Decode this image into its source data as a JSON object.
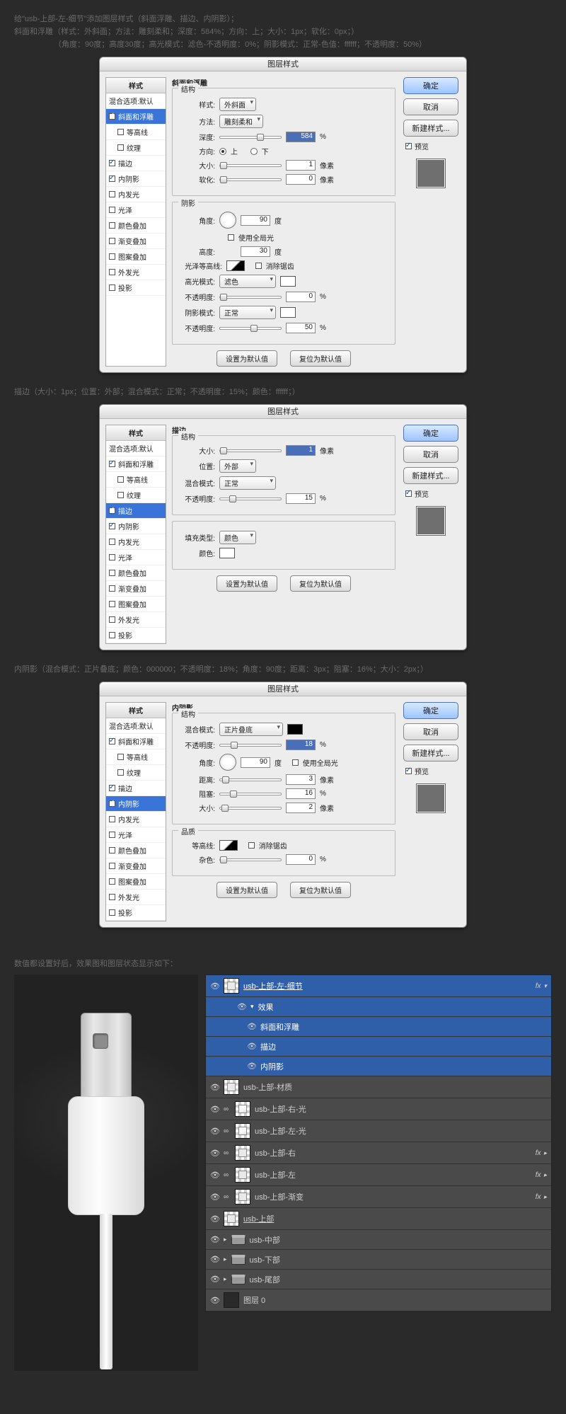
{
  "intro": {
    "line1": "给\"usb-上部-左-细节\"添加图层样式（斜面浮雕、描边、内阴影）；",
    "line2": "斜面和浮雕（样式：外斜面；方法：雕刻柔和；深度：584%；方向：上；大小：1px；软化：0px；）",
    "line3": "（角度：90度；高度30度；高光模式：滤色-不透明度：0%；阴影模式：正常-色值：ffffff；不透明度：50%）"
  },
  "strokeIntro": "描边（大小：1px；位置：外部；混合模式：正常；不透明度：15%；颜色：ffffff；）",
  "innerIntro": "内阴影（混合模式：正片叠底；颜色：000000；不透明度：18%；角度：90度；距离：3px；阻塞：16%；大小：2px；）",
  "resultIntro": "数值都设置好后，效果图和图层状态显示如下：",
  "dlg": {
    "title": "图层样式",
    "ok": "确定",
    "cancel": "取消",
    "new": "新建样式...",
    "preview": "预览",
    "defaultBtn": "设置为默认值",
    "resetBtn": "复位为默认值"
  },
  "styles": {
    "head": "样式",
    "default": "混合选项:默认",
    "items": [
      "斜面和浮雕",
      "等高线",
      "纹理",
      "描边",
      "内阴影",
      "内发光",
      "光泽",
      "颜色叠加",
      "渐变叠加",
      "图案叠加",
      "外发光",
      "投影"
    ]
  },
  "bevel": {
    "title": "斜面和浮雕",
    "structure": "结构",
    "styleLbl": "样式:",
    "styleVal": "外斜面",
    "methodLbl": "方法:",
    "methodVal": "雕刻柔和",
    "depthLbl": "深度:",
    "depthVal": "584",
    "pct": "%",
    "dirLbl": "方向:",
    "up": "上",
    "down": "下",
    "sizeLbl": "大小:",
    "sizeVal": "1",
    "px": "像素",
    "softLbl": "软化:",
    "softVal": "0",
    "shade": "阴影",
    "angleLbl": "角度:",
    "angleVal": "90",
    "deg": "度",
    "globalLight": "使用全局光",
    "altLbl": "高度:",
    "altVal": "30",
    "glossLbl": "光泽等高线:",
    "anti": "消除锯齿",
    "hlModeLbl": "高光模式:",
    "hlModeVal": "滤色",
    "opLbl": "不透明度:",
    "hlOp": "0",
    "shModeLbl": "阴影模式:",
    "shModeVal": "正常",
    "shOp": "50"
  },
  "stroke": {
    "title": "描边",
    "structure": "结构",
    "sizeLbl": "大小:",
    "sizeVal": "1",
    "px": "像素",
    "posLbl": "位置:",
    "posVal": "外部",
    "blendLbl": "混合模式:",
    "blendVal": "正常",
    "opLbl": "不透明度:",
    "opVal": "15",
    "pct": "%",
    "fillType": "填充类型:",
    "fillVal": "颜色",
    "colorLbl": "颜色:"
  },
  "inner": {
    "title": "内阴影",
    "structure": "结构",
    "blendLbl": "混合模式:",
    "blendVal": "正片叠底",
    "opLbl": "不透明度:",
    "opVal": "18",
    "pct": "%",
    "angleLbl": "角度:",
    "angleVal": "90",
    "deg": "度",
    "global": "使用全局光",
    "distLbl": "距离:",
    "distVal": "3",
    "px": "像素",
    "chokeLbl": "阻塞:",
    "chokeVal": "16",
    "sizeLbl": "大小:",
    "sizeVal": "2",
    "quality": "品质",
    "contourLbl": "等高线:",
    "anti": "消除锯齿",
    "noiseLbl": "杂色:",
    "noiseVal": "0"
  },
  "layers": {
    "fx": "fx",
    "effects": "效果",
    "eff_bevel": "斜面和浮雕",
    "eff_stroke": "描边",
    "eff_inner": "内阴影",
    "rows": [
      {
        "name": "usb-上部-左-细节",
        "fx": true,
        "sel": true
      },
      {
        "name": "usb-上部-材质"
      },
      {
        "name": "usb-上部-右-光"
      },
      {
        "name": "usb-上部-左-光"
      },
      {
        "name": "usb-上部-右",
        "fx": true
      },
      {
        "name": "usb-上部-左",
        "fx": true
      },
      {
        "name": "usb-上部-渐变",
        "fx": true
      },
      {
        "name": "usb-上部",
        "underline": true
      }
    ],
    "folders": [
      "usb-中部",
      "usb-下部",
      "usb-尾部"
    ],
    "bg": "图层 0"
  }
}
